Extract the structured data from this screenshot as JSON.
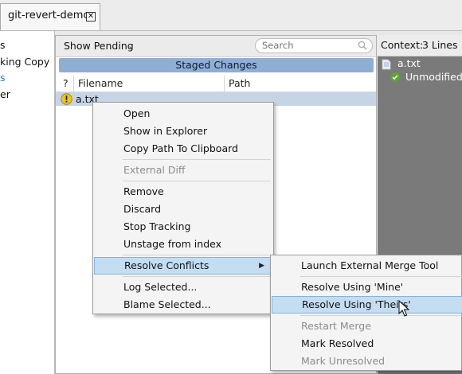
{
  "tab": {
    "title": "git-revert-demo",
    "close_glyph": "✕"
  },
  "left_panel": {
    "items": [
      "s",
      "king Copy",
      "s",
      "er"
    ]
  },
  "center": {
    "filter_label": "Show Pending",
    "search_placeholder": "Search",
    "staged_header": "Staged Changes",
    "columns": [
      "?",
      "Filename",
      "Path"
    ],
    "file": {
      "status_icon": "warning-icon",
      "name": "a.txt"
    }
  },
  "right_panel": {
    "context_label": "Context:",
    "context_value": "3 Lines",
    "file_name": "a.txt",
    "status_text": "Unmodified file"
  },
  "context_menu": {
    "items": [
      "Open",
      "Show in Explorer",
      "Copy Path To Clipboard",
      "External Diff",
      "Remove",
      "Discard",
      "Stop Tracking",
      "Unstage from index",
      "Resolve Conflicts",
      "Log Selected...",
      "Blame Selected..."
    ]
  },
  "resolve_submenu": {
    "items": [
      "Launch External Merge Tool",
      "Resolve Using 'Mine'",
      "Resolve Using 'Theirs'",
      "Restart Merge",
      "Mark Resolved",
      "Mark Unresolved"
    ]
  },
  "colors": {
    "accent": "#8faed6",
    "menu_hover": "#c5ddf1",
    "right_panel_bg": "#7a7a7a",
    "warning": "#f2c31a",
    "success": "#5aa828"
  }
}
